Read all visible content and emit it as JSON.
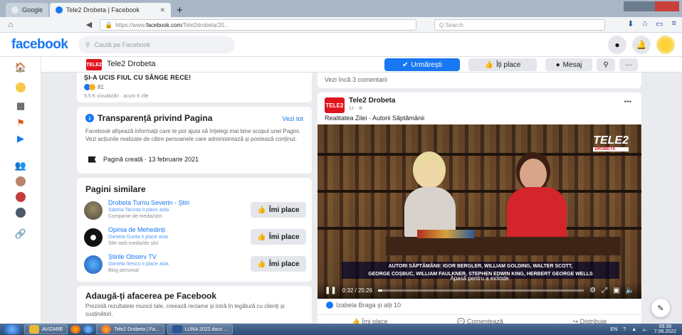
{
  "browser": {
    "tabs": [
      {
        "label": "Google"
      },
      {
        "label": "Tele2 Drobeta | Facebook"
      }
    ],
    "url_prefix": "https://www.",
    "url_domain": "facebook.com",
    "url_path": "/Tele2drobeta/20...",
    "search_placeholder": "Q Search"
  },
  "facebook": {
    "logo": "facebook",
    "search_placeholder": "Caută pe Facebook"
  },
  "page_header": {
    "logo_text": "TELE2",
    "name": "Tele2 Drobeta",
    "follow_label": "Urmărești",
    "like_label": "Îți place",
    "message_label": "Mesaj",
    "more_label": "···"
  },
  "prev_post": {
    "title": "ȘI-A UCIS FIUL CU SÂNGE RECE!",
    "reactions": "81",
    "meta": "9,5 K vizualizări · acum 6 zile"
  },
  "transparency": {
    "title": "Transparență privind Pagina",
    "see_all": "Vezi tot",
    "description": "Facebook afișează informații care te pot ajuta să înțelegi mai bine scopul unei Pagini. Vezi acțiunile realizate de către persoanele care administrează și postează conținut.",
    "created": "Pagină creată · 13 februarie 2021"
  },
  "similar_pages": {
    "title": "Pagini similare",
    "like_label": "Îmi place",
    "items": [
      {
        "name": "Drobeta Turnu Severin - Știri",
        "sub": "Sabina Tacoita îi place asta",
        "cat": "Companie de media/știri"
      },
      {
        "name": "Opinia de Mehedinți",
        "sub": "Daniela Gurita îi place asta",
        "cat": "Site web media/de știri"
      },
      {
        "name": "Știrile Observ TV",
        "sub": "Daniela Iliescu îi place asta",
        "cat": "Blog personal"
      }
    ]
  },
  "add_business": {
    "title": "Adaugă-ți afacerea pe Facebook",
    "description": "Prezintă rezultatele muncii tale, creează reclame și intră în legătură cu clienți și susținători."
  },
  "comments_link": "Vezi încă 3 comentarii",
  "post": {
    "author": "Tele2 Drobeta",
    "meta": "1z · ⊛",
    "caption": "Realitatea Zilei - Autorii Săptămânii",
    "video": {
      "channel": "TELE2",
      "channel_sub": "DROBETA",
      "lower_third_1": "AUTORI SĂPTĂMÂNII: IGOR BERGLER, WILLIAM GOLDING, WALTER SCOTT,",
      "lower_third_2": "GEORGE COȘBUC, WILLIAM FAULKNER, STEPHEN EDWIN KING, HERBERT GEORGE WELLS",
      "expand_hint": "Apasă pentru a extinde",
      "time": "0:32 / 25:26",
      "progress": 0.02
    },
    "reactions": "Izabela Braga și alți 10",
    "actions": {
      "like": "Îmi place",
      "comment": "Comentează",
      "share": "Distribuie"
    }
  },
  "taskbar": {
    "items": [
      "AVIZARE",
      "Tele2 Drobeta | Fa...",
      "LUNA 2022.docx ..."
    ],
    "lang": "EN",
    "time": "09:39",
    "date": "7.06.2022"
  },
  "colors": {
    "accent": "#1877f2",
    "brand_red": "#e0141e"
  }
}
